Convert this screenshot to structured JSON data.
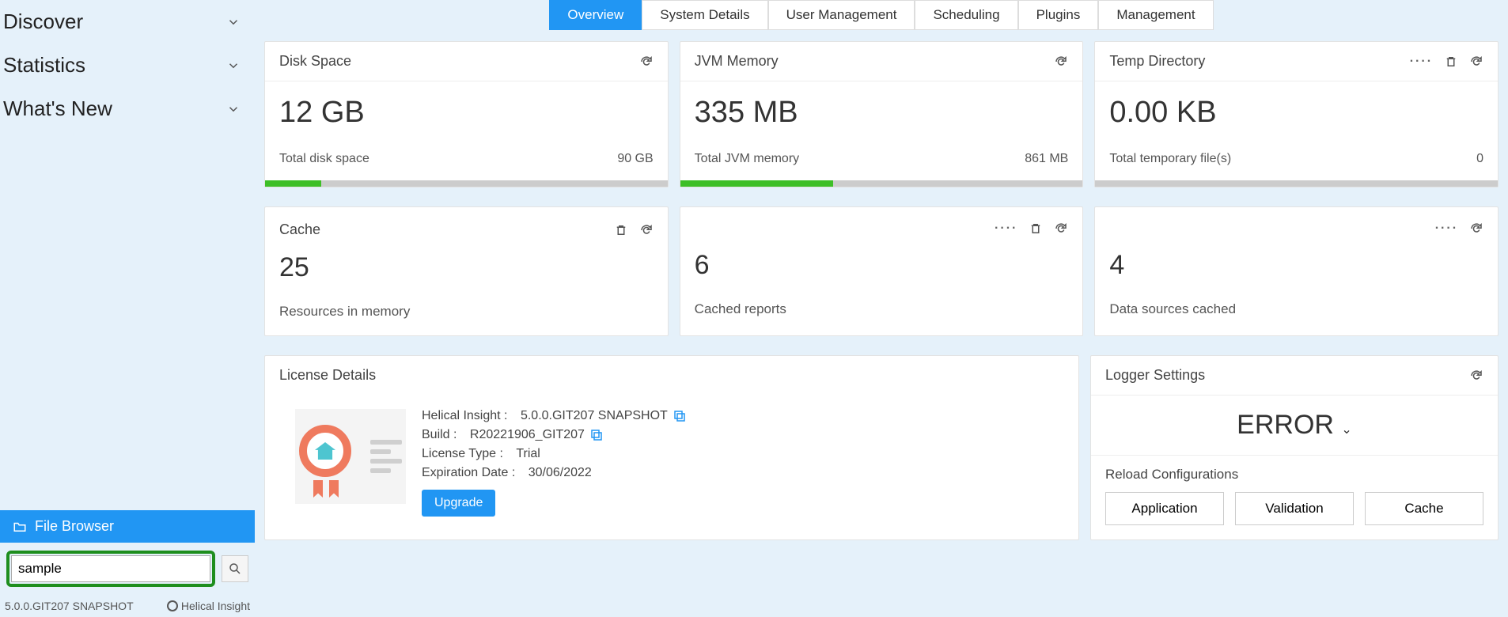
{
  "sidebar": {
    "items": [
      {
        "label": "Discover"
      },
      {
        "label": "Statistics"
      },
      {
        "label": "What's New"
      }
    ],
    "file_browser_label": "File Browser",
    "search_value": "sample",
    "version": "5.0.0.GIT207 SNAPSHOT",
    "brand": "Helical Insight"
  },
  "tabs": [
    {
      "label": "Overview",
      "active": true
    },
    {
      "label": "System Details"
    },
    {
      "label": "User Management"
    },
    {
      "label": "Scheduling"
    },
    {
      "label": "Plugins"
    },
    {
      "label": "Management"
    }
  ],
  "row1": [
    {
      "title": "Disk Space",
      "value": "12 GB",
      "sub_left": "Total disk space",
      "sub_right": "90 GB",
      "progress": 14,
      "icons": [
        "refresh"
      ]
    },
    {
      "title": "JVM Memory",
      "value": "335 MB",
      "sub_left": "Total JVM memory",
      "sub_right": "861 MB",
      "progress": 38,
      "icons": [
        "refresh"
      ]
    },
    {
      "title": "Temp Directory",
      "value": "0.00 KB",
      "sub_left": "Total temporary file(s)",
      "sub_right": "0",
      "progress": 0,
      "icons": [
        "more",
        "trash",
        "refresh"
      ]
    }
  ],
  "row2": [
    {
      "title": "Cache",
      "value": "25",
      "sub": "Resources in memory",
      "icons_head": [
        "trash",
        "refresh"
      ]
    },
    {
      "title": "",
      "value": "6",
      "sub": "Cached reports",
      "icons_head": [
        "more",
        "trash",
        "refresh"
      ]
    },
    {
      "title": "",
      "value": "4",
      "sub": "Data sources cached",
      "icons_head": [
        "more",
        "refresh"
      ]
    }
  ],
  "license": {
    "title": "License Details",
    "lines": {
      "product_label": "Helical Insight :",
      "product_value": "5.0.0.GIT207 SNAPSHOT",
      "build_label": "Build :",
      "build_value": "R20221906_GIT207",
      "type_label": "License Type :",
      "type_value": "Trial",
      "exp_label": "Expiration Date :",
      "exp_value": "30/06/2022"
    },
    "upgrade": "Upgrade"
  },
  "logger": {
    "title": "Logger Settings",
    "level": "ERROR",
    "reload_label": "Reload Configurations",
    "buttons": [
      "Application",
      "Validation",
      "Cache"
    ]
  }
}
